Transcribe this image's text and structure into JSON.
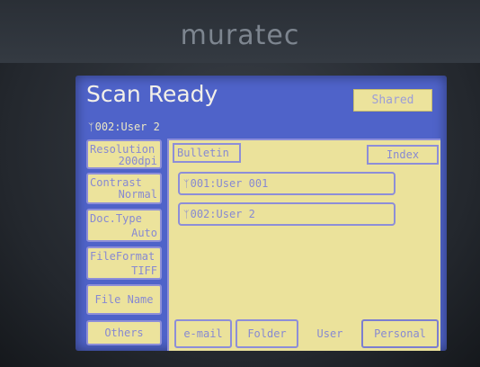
{
  "device": {
    "brand": "muratec"
  },
  "screen": {
    "title": "Scan Ready",
    "shared_label": "Shared",
    "current_user_id": "002:User 2"
  },
  "left_buttons": [
    {
      "line1": "Resolution",
      "line2": "200dpi"
    },
    {
      "line1": "Contrast",
      "line2": "Normal"
    },
    {
      "line1": "Doc.Type",
      "line2": "Auto"
    },
    {
      "line1": "FileFormat",
      "line2": "TIFF"
    },
    {
      "label": "File Name"
    },
    {
      "label": "Others"
    }
  ],
  "panel": {
    "bulletin_label": "Bulletin",
    "index_label": "Index",
    "entries": [
      "001:User 001",
      "002:User 2"
    ]
  },
  "tabs": [
    "e-mail",
    "Folder",
    "User",
    "Personal"
  ],
  "icons": {
    "user": "user-icon"
  },
  "colors": {
    "screen_bg": "#4f63c9",
    "panel_bg": "#ebe29b",
    "accent_border": "#8d8ed8",
    "button_text": "#8789d2"
  }
}
